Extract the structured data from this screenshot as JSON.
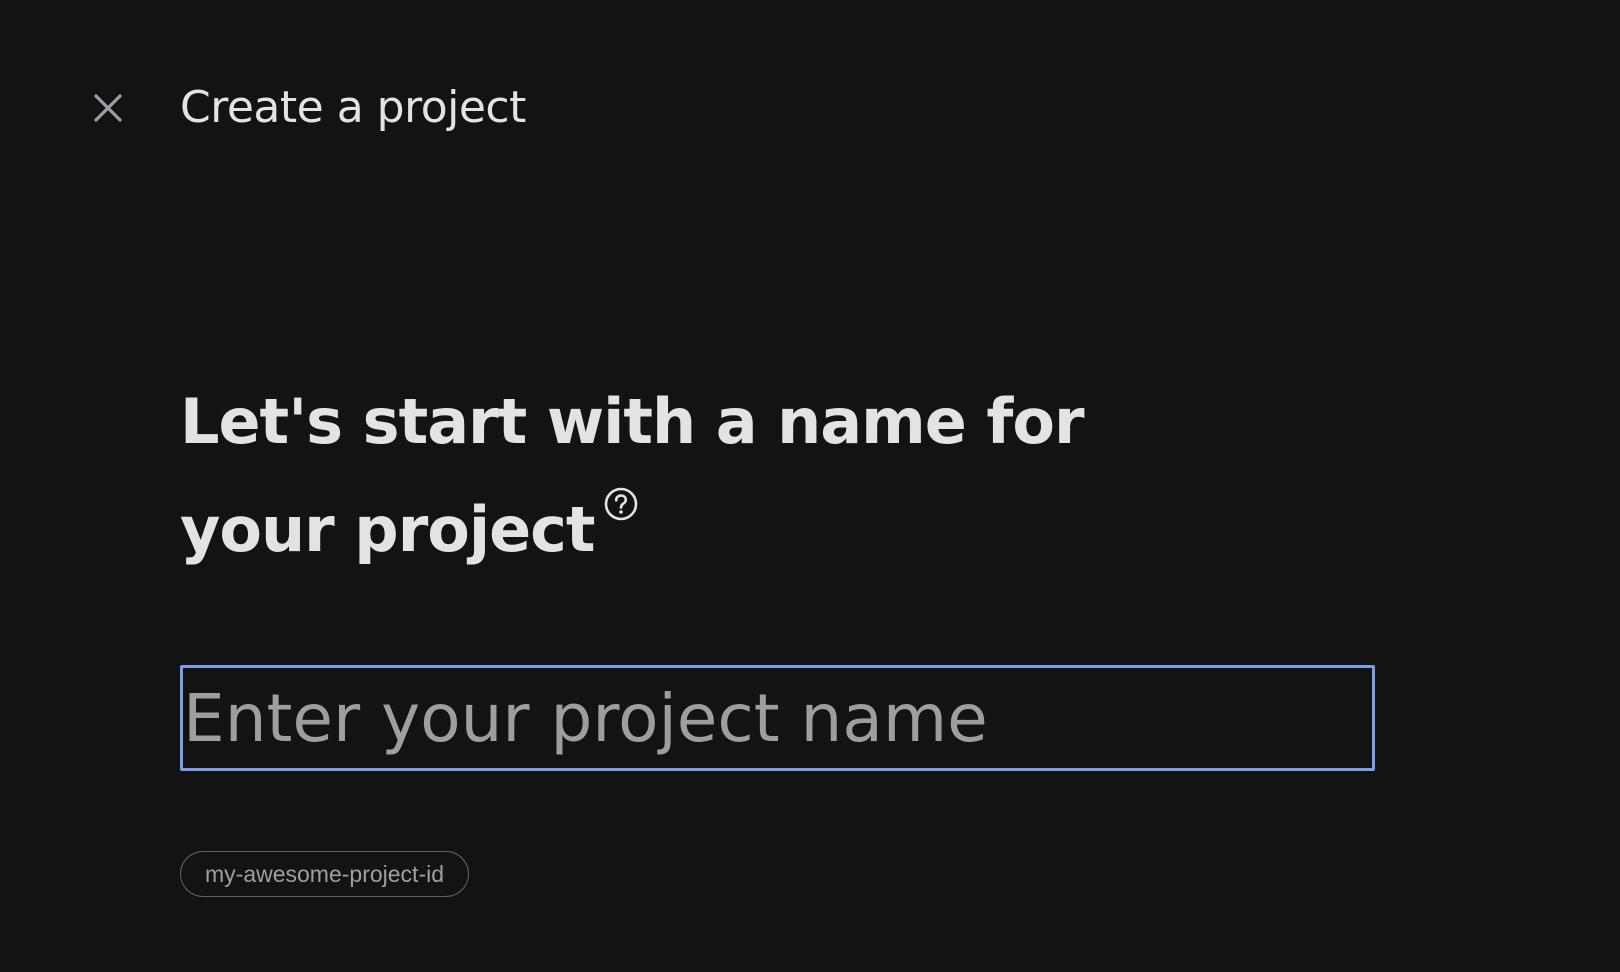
{
  "header": {
    "close_icon": "close-icon",
    "title": "Create a project"
  },
  "main": {
    "headline_line1": "Let's start with a name for",
    "headline_line2": "your project",
    "help_icon": "help-circle-icon",
    "name_input": {
      "placeholder": "Enter your project name",
      "value": ""
    },
    "project_id_chip": "my-awesome-project-id"
  },
  "colors": {
    "background": "#131313",
    "text_primary": "#e3e3e3",
    "placeholder": "#9e9e9e",
    "focus_border": "#7b9ee8",
    "chip_border": "#5f6368",
    "chip_text": "#9aa0a6"
  }
}
